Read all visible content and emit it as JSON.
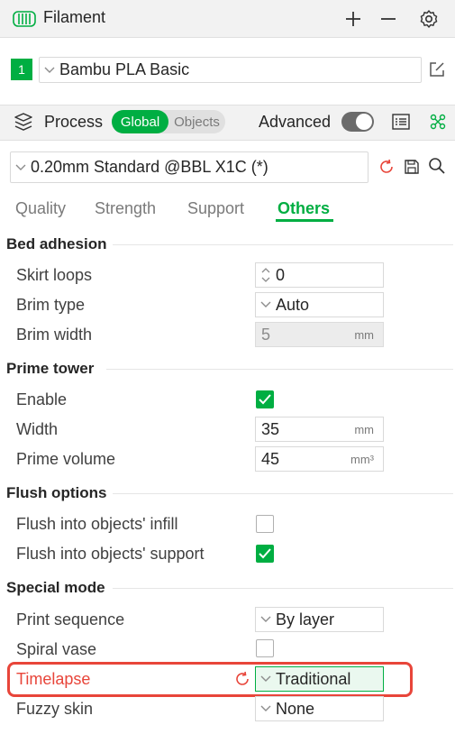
{
  "filament": {
    "title": "Filament",
    "slot_number": "1",
    "preset": "Bambu PLA Basic",
    "icons": [
      "filament-spool-icon",
      "plus-icon",
      "minus-icon",
      "gear-icon",
      "edit-icon"
    ]
  },
  "process": {
    "title": "Process",
    "scope_options": [
      "Global",
      "Objects"
    ],
    "scope_selected": "Global",
    "advanced_label": "Advanced",
    "advanced_on": false,
    "preset": "0.20mm Standard @BBL X1C (*)"
  },
  "tabs": {
    "items": [
      "Quality",
      "Strength",
      "Support",
      "Others"
    ],
    "active": "Others"
  },
  "sections": {
    "bed_adhesion": {
      "title": "Bed adhesion",
      "skirt_loops": {
        "label": "Skirt loops",
        "value": "0"
      },
      "brim_type": {
        "label": "Brim type",
        "value": "Auto"
      },
      "brim_width": {
        "label": "Brim width",
        "value": "5",
        "unit": "mm"
      }
    },
    "prime_tower": {
      "title": "Prime tower",
      "enable": {
        "label": "Enable",
        "checked": true
      },
      "width": {
        "label": "Width",
        "value": "35",
        "unit": "mm"
      },
      "prime_volume": {
        "label": "Prime volume",
        "value": "45",
        "unit": "mm³"
      }
    },
    "flush_options": {
      "title": "Flush options",
      "into_infill": {
        "label": "Flush into objects' infill",
        "checked": false
      },
      "into_support": {
        "label": "Flush into objects' support",
        "checked": true
      }
    },
    "special_mode": {
      "title": "Special mode",
      "print_sequence": {
        "label": "Print sequence",
        "value": "By layer"
      },
      "spiral_vase": {
        "label": "Spiral vase",
        "checked": false
      },
      "timelapse": {
        "label": "Timelapse",
        "value": "Traditional"
      },
      "fuzzy_skin": {
        "label": "Fuzzy skin",
        "value": "None"
      }
    }
  },
  "colors": {
    "accent": "#00ae42",
    "modified": "#e8453a"
  }
}
